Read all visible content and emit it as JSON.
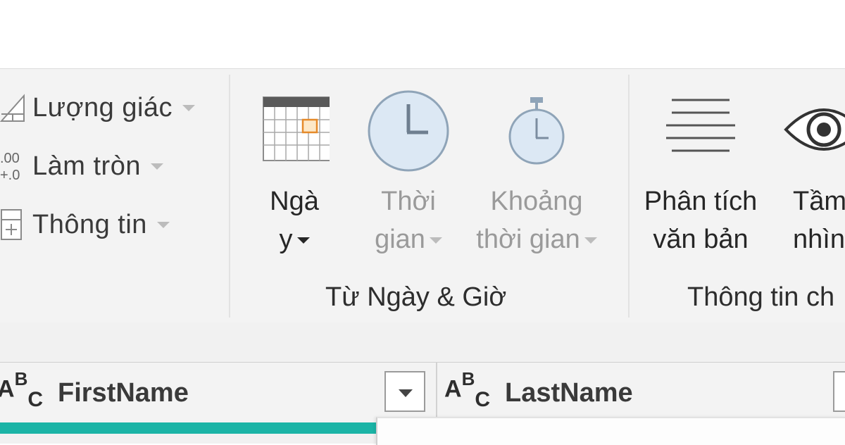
{
  "ribbon": {
    "number_group": {
      "items": [
        {
          "label": "Lượng giác",
          "icon": "trigonometry-icon"
        },
        {
          "label": "Làm tròn",
          "icon": "rounding-icon"
        },
        {
          "label": "Thông tin",
          "icon": "information-icon"
        }
      ]
    },
    "datetime_group": {
      "label": "Từ Ngày & Giờ",
      "date_button": {
        "line1": "Ngà",
        "line2": "y",
        "icon": "calendar-icon"
      },
      "time_button": {
        "line1": "Thời",
        "line2": "gian",
        "icon": "clock-icon",
        "enabled": false
      },
      "duration_button": {
        "line1": "Khoảng",
        "line2": "thời gian",
        "icon": "stopwatch-icon",
        "enabled": false
      }
    },
    "ai_group": {
      "label": "Thông tin ch",
      "text_analytics_button": {
        "line1": "Phân tích",
        "line2": "văn bản",
        "icon": "text-lines-icon"
      },
      "vision_button": {
        "line1": "Tầm",
        "line2": "nhìn",
        "icon": "eye-icon"
      }
    }
  },
  "grid": {
    "columns": [
      {
        "type_icon": "text-type-icon",
        "type_a": "A",
        "type_b": "B",
        "type_c": "C",
        "name": "FirstName"
      },
      {
        "type_icon": "text-type-icon",
        "type_a": "A",
        "type_b": "B",
        "type_c": "C",
        "name": "LastName"
      }
    ],
    "quality_color": "#1bb4a6"
  }
}
